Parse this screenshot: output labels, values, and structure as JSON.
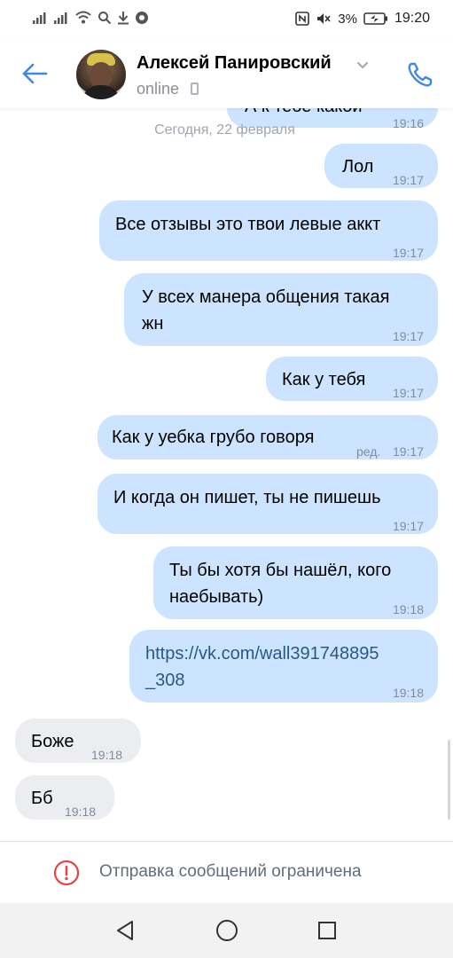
{
  "status_bar": {
    "battery_percent": "3%",
    "time": "19:20",
    "icons": [
      "signal-icon",
      "signal-icon",
      "wifi-icon",
      "search-icon",
      "download-icon",
      "shield-icon",
      "nfc-icon",
      "mute-icon",
      "battery-icon"
    ]
  },
  "header": {
    "contact_name": "Алексей Панировский",
    "status": "online",
    "icons": [
      "back-arrow-icon",
      "chevron-down-icon",
      "phone-icon",
      "call-icon"
    ]
  },
  "chat": {
    "partial_message": {
      "text": "А к тебе какой",
      "time": "19:16"
    },
    "date_separator": "Сегодня, 22 февраля",
    "messages": [
      {
        "direction": "out",
        "lines": [
          "Лол"
        ],
        "time": "19:17"
      },
      {
        "direction": "out",
        "lines": [
          "Все отзывы это твои левые аккт"
        ],
        "time": "19:17"
      },
      {
        "direction": "out",
        "lines": [
          "У всех манера общения такая",
          "жн"
        ],
        "time": "19:17"
      },
      {
        "direction": "out",
        "lines": [
          "Как у тебя"
        ],
        "time": "19:17"
      },
      {
        "direction": "out",
        "lines": [
          "Как у уебка грубо говоря"
        ],
        "edited": "ред.",
        "time": "19:17"
      },
      {
        "direction": "out",
        "lines": [
          "И когда он пишет, ты не пишешь"
        ],
        "time": "19:17"
      },
      {
        "direction": "out",
        "lines": [
          "Ты бы хотя бы нашёл, кого",
          "наебывать)"
        ],
        "time": "19:18"
      },
      {
        "direction": "out",
        "lines": [
          "https://vk.com/wall391748895",
          "_308"
        ],
        "time": "19:18",
        "is_link": true
      },
      {
        "direction": "in",
        "lines": [
          "Боже"
        ],
        "time": "19:18"
      },
      {
        "direction": "in",
        "lines": [
          "Бб"
        ],
        "time": "19:18"
      }
    ]
  },
  "restriction": {
    "text": "Отправка сообщений ограничена",
    "icon": "warning-icon",
    "color": "#e64646"
  },
  "nav_bar": {
    "icons": [
      "back-triangle-icon",
      "home-circle-icon",
      "recents-square-icon"
    ]
  },
  "colors": {
    "accent": "#3f8ae0",
    "outgoing_bubble": "#cce4ff",
    "incoming_bubble": "#ebedf0",
    "link": "#2a5885"
  }
}
